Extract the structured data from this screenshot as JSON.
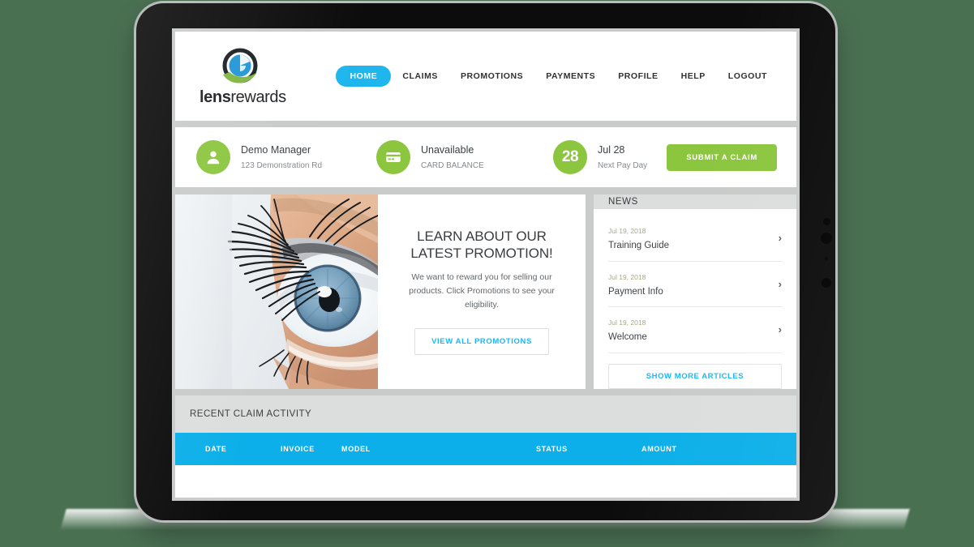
{
  "brand": {
    "name_bold": "lens",
    "name_light": "rewards",
    "logo_icon": "lens-eye-logo-icon",
    "colors": {
      "ring": "#1b2024",
      "iris": "#2196d6",
      "leaf": "#7fb63f"
    }
  },
  "nav": {
    "items": [
      {
        "label": "HOME",
        "active": true
      },
      {
        "label": "CLAIMS",
        "active": false
      },
      {
        "label": "PROMOTIONS",
        "active": false
      },
      {
        "label": "PAYMENTS",
        "active": false
      },
      {
        "label": "PROFILE",
        "active": false
      },
      {
        "label": "HELP",
        "active": false
      },
      {
        "label": "LOGOUT",
        "active": false
      }
    ],
    "active_color": "#1fb6ee"
  },
  "info_bar": {
    "user": {
      "icon": "person-icon",
      "name": "Demo Manager",
      "address": "123 Demonstration Rd"
    },
    "balance": {
      "icon": "credit-card-icon",
      "value": "Unavailable",
      "label": "CARD BALANCE"
    },
    "payday": {
      "day": "28",
      "date": "Jul 28",
      "label": "Next Pay Day"
    },
    "submit_button": "SUBMIT A CLAIM",
    "accent_color": "#8cc63f"
  },
  "promo": {
    "image_alt": "close-up-eye-photo",
    "heading_line1": "LEARN ABOUT OUR",
    "heading_line2": "LATEST PROMOTION!",
    "body": "We want to reward you for selling our products. Click Promotions to see your eligibility.",
    "button": "VIEW ALL PROMOTIONS"
  },
  "news": {
    "title": "NEWS",
    "items": [
      {
        "date": "Jul 19, 2018",
        "title": "Training Guide",
        "chevron": "›"
      },
      {
        "date": "Jul 19, 2018",
        "title": "Payment Info",
        "chevron": "›"
      },
      {
        "date": "Jul 19, 2018",
        "title": "Welcome",
        "chevron": "›"
      }
    ],
    "show_more": "SHOW MORE ARTICLES"
  },
  "claim_activity": {
    "title": "RECENT CLAIM ACTIVITY",
    "columns": [
      "DATE",
      "INVOICE",
      "MODEL",
      "STATUS",
      "AMOUNT"
    ],
    "rows": [],
    "header_color": "#0cafe9"
  }
}
